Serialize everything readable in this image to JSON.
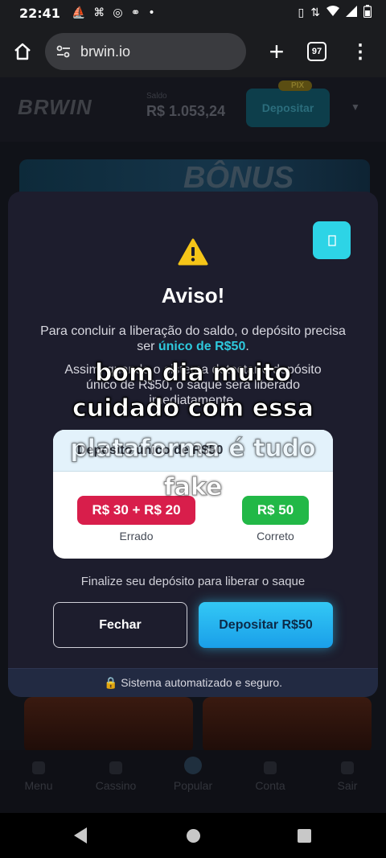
{
  "statusbar": {
    "time": "22:41",
    "icons_left": [
      "boat-icon",
      "link-icon",
      "instagram-icon",
      "voicemail-icon",
      "dot-icon"
    ],
    "icons_right": [
      "vibrate-icon",
      "data-icon",
      "wifi-icon",
      "signal-icon",
      "battery-icon"
    ]
  },
  "browser": {
    "url": "brwin.io",
    "tab_count": "97"
  },
  "site": {
    "logo": "BRWIN",
    "balance_label": "Saldo",
    "balance": "R$  1.053,24",
    "deposit_label": "Depositar",
    "pix_tag": "PIX",
    "banner_text": "BÔNUS",
    "nav": [
      {
        "label": "Menu"
      },
      {
        "label": "Cassino"
      },
      {
        "label": "Popular"
      },
      {
        "label": "Conta"
      },
      {
        "label": "Sair"
      }
    ]
  },
  "modal": {
    "title": "Aviso!",
    "msg_part1": "Para concluir a liberação do saldo, o depósito precisa ser ",
    "msg_highlight": "único de R$50",
    "msg_part2": ".",
    "msg2": "Assim, quando o sistema detectar o depósito único de R$50, o saque será liberado imediatamente.",
    "compare": {
      "header": "Depósito único de R$50",
      "wrong_value": "R$ 30 + R$ 20",
      "wrong_label": "Errado",
      "right_value": "R$ 50",
      "right_label": "Correto"
    },
    "finalize": "Finalize seu depósito para liberar o saque",
    "close_label": "Fechar",
    "deposit_label": "Depositar R$50",
    "footer": "🔒 Sistema automatizado e seguro."
  },
  "caption": {
    "line1": "bom dia muito",
    "line2": "cuidado com essa",
    "line3": "plataforma é tudo",
    "line4": "fake"
  },
  "colors": {
    "accent": "#2dd4e6",
    "wrong": "#d81e4b",
    "right": "#22b847",
    "modal_bg": "#1d1d2d"
  }
}
